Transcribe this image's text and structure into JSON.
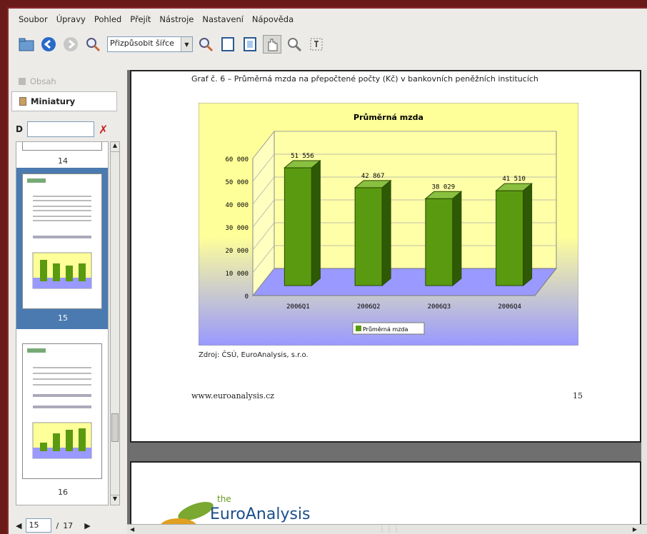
{
  "menu": [
    "Soubor",
    "Úpravy",
    "Pohled",
    "Přejít",
    "Nástroje",
    "Nastavení",
    "Nápověda"
  ],
  "toolbar": {
    "zoom_value": "Přizpůsobit šířce"
  },
  "sidebar": {
    "tab_contents": "Obsah",
    "tab_thumbnails": "Miniatury",
    "thumbs": [
      "14",
      "15",
      "16"
    ]
  },
  "pager": {
    "current": "15",
    "sep": "/",
    "total": "17"
  },
  "page": {
    "caption": "Graf č. 6 – Průměrná mzda na přepočtené počty (Kč) v bankovních peněžních institucích",
    "source": "Zdroj: ČSÚ, EuroAnalysis, s.r.o.",
    "url": "www.euroanalysis.cz",
    "number": "15",
    "logo_small": "the",
    "logo": "EuroAnalysis"
  },
  "chart_data": {
    "type": "bar",
    "title": "Průměrná mzda",
    "categories": [
      "2006Q1",
      "2006Q2",
      "2006Q3",
      "2006Q4"
    ],
    "series": [
      {
        "name": "Průměrná mzda",
        "values": [
          51556,
          42867,
          38029,
          41510
        ]
      }
    ],
    "value_labels": [
      "51 556",
      "42 867",
      "38 029",
      "41 510"
    ],
    "yticks": [
      "0",
      "10 000",
      "20 000",
      "30 000",
      "40 000",
      "50 000",
      "60 000"
    ],
    "ylim": [
      0,
      60000
    ],
    "legend": "bottom",
    "colors": {
      "bar": "#5a9a10",
      "wall": "#ffff99",
      "floor": "#9999ff"
    }
  }
}
